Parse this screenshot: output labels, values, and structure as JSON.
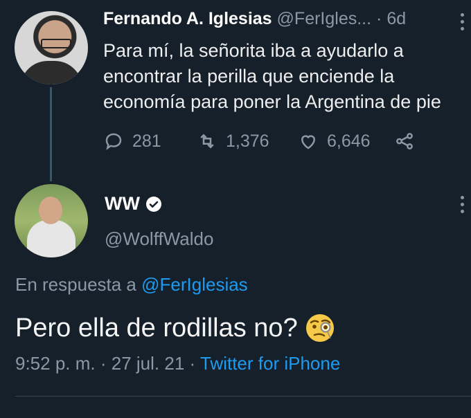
{
  "parent_tweet": {
    "name": "Fernando A. Iglesias",
    "handle": "@FerIgles...",
    "separator": "·",
    "time": "6d",
    "text": "Para mí, la señorita iba a ayudarlo a encontrar la perilla que enciende la economía para poner la Argentina de pie",
    "replies": "281",
    "retweets": "1,376",
    "likes": "6,646"
  },
  "reply_tweet": {
    "name": "WW",
    "handle": "@WolffWaldo",
    "reply_prefix": "En respuesta a",
    "reply_mention": "@FerIglesias",
    "text": "Pero ella de rodillas no?",
    "time": "9:52 p. m.",
    "date": "27 jul. 21",
    "separator": "·",
    "source": "Twitter for iPhone"
  },
  "colors": {
    "background": "#15202b",
    "accent": "#1d9bf0",
    "secondary_text": "#8b98a5"
  }
}
